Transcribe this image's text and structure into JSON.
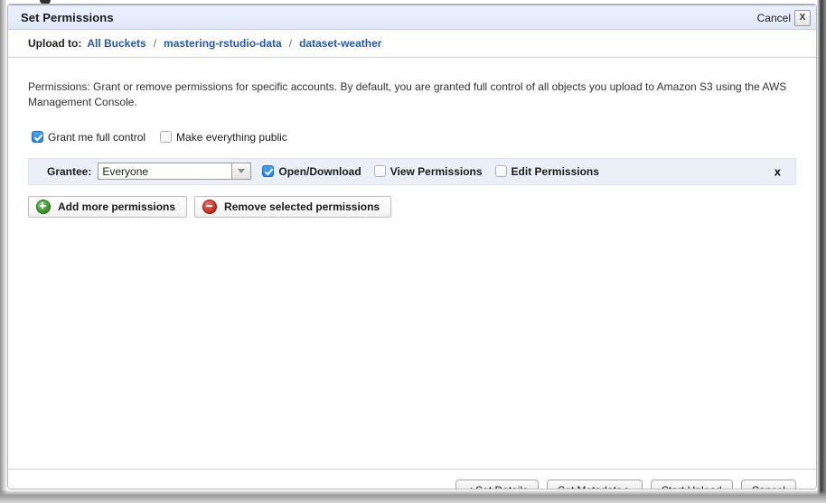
{
  "titlebar": {
    "title": "Set Permissions",
    "cancel_label": "Cancel",
    "close_label": "X"
  },
  "breadcrumb": {
    "label": "Upload to:",
    "separator": "/",
    "items": [
      {
        "label": "All Buckets"
      },
      {
        "label": "mastering-rstudio-data"
      },
      {
        "label": "dataset-weather"
      }
    ]
  },
  "body": {
    "description": "Permissions: Grant or remove permissions for specific accounts. By default, you are granted full control of all objects you upload to Amazon S3 using the AWS Management Console.",
    "global_checks": [
      {
        "label": "Grant me full control",
        "checked": true
      },
      {
        "label": "Make everything public",
        "checked": false
      }
    ],
    "grantee": {
      "label": "Grantee:",
      "value": "Everyone",
      "placeholder": "Everyone",
      "dropdown_icon": "chevron-down-icon",
      "remove_icon": "x-icon",
      "permissions": [
        {
          "label": "Open/Download",
          "checked": true
        },
        {
          "label": "View Permissions",
          "checked": false
        },
        {
          "label": "Edit Permissions",
          "checked": false
        }
      ]
    },
    "actions": [
      {
        "label": "Add more permissions",
        "icon": "plus-circle-icon"
      },
      {
        "label": "Remove selected permissions",
        "icon": "minus-circle-icon"
      }
    ]
  },
  "footer": {
    "buttons": [
      {
        "label": "< Set Details"
      },
      {
        "label": "Set Metadata >"
      },
      {
        "label": "Start Upload"
      },
      {
        "label": "Cancel"
      }
    ]
  },
  "colors": {
    "titlebar_bg": "#e6ecfa",
    "link": "#2559a8",
    "grantee_row_bg": "#eaeff8",
    "checkbox_on": "#1f84e8",
    "icon_add": "#2e8b22",
    "icon_remove": "#c32116"
  }
}
